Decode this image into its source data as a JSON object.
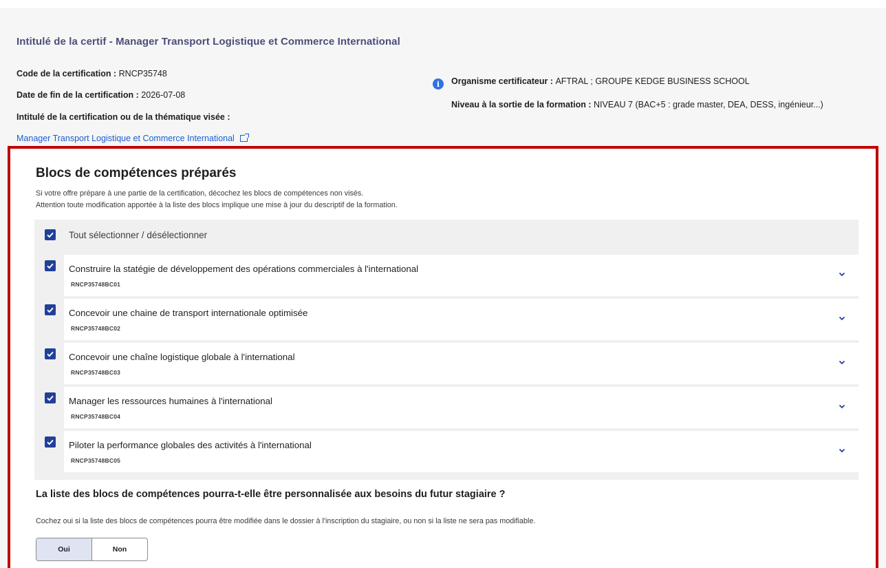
{
  "certification": {
    "title": "Intitulé de la certif - Manager Transport Logistique et Commerce International",
    "code_key": "Code de la certification : ",
    "code_value": "RNCP35748",
    "end_date_key": "Date de fin de la certification : ",
    "end_date_value": "2026-07-08",
    "theme_key": "Intitulé de la certification ou de la thématique visée :",
    "link_text": "Manager Transport Logistique et Commerce International",
    "org_key": "Organisme certificateur : ",
    "org_value": "AFTRAL ; GROUPE KEDGE BUSINESS SCHOOL",
    "level_key": "Niveau à la sortie de la formation : ",
    "level_value": "NIVEAU 7 (BAC+5 : grade master, DEA, DESS, ingénieur...)"
  },
  "blocs": {
    "title": "Blocs de compétences préparés",
    "hint_1": "Si votre offre prépare à une partie de la certification, décochez les blocs de compétences non visés.",
    "hint_2": "Attention toute modification apportée à la liste des blocs implique une mise à jour du descriptif de la formation.",
    "select_all_label": "Tout sélectionner / désélectionner",
    "items": [
      {
        "name": "Construire la statégie de développement des opérations commerciales à l'international",
        "code": "RNCP35748BC01",
        "checked": true
      },
      {
        "name": "Concevoir une chaine de transport internationale optimisée",
        "code": "RNCP35748BC02",
        "checked": true
      },
      {
        "name": "Concevoir une chaîne logistique globale à l'international",
        "code": "RNCP35748BC03",
        "checked": true
      },
      {
        "name": "Manager les ressources humaines à l'international",
        "code": "RNCP35748BC04",
        "checked": true
      },
      {
        "name": "Piloter la performance globales des activités à l'international",
        "code": "RNCP35748BC05",
        "checked": true
      }
    ]
  },
  "personalisation": {
    "question": "La liste des blocs de compétences pourra-t-elle être personnalisée aux besoins du futur stagiaire ?",
    "hint": "Cochez oui si la liste des blocs de compétences pourra être modifiée dans le dossier à l'inscription du stagiaire, ou non si la liste ne sera pas modifiable.",
    "yes_label": "Oui",
    "no_label": "Non",
    "selected": "Oui"
  },
  "colors": {
    "accent": "#21409a",
    "link": "#1a5fd0",
    "highlight_frame": "#c00000",
    "title_blue": "#4a4e7a"
  },
  "icons": [
    "info-icon",
    "external-link-icon",
    "checkbox-checked-icon",
    "chevron-down-icon"
  ]
}
